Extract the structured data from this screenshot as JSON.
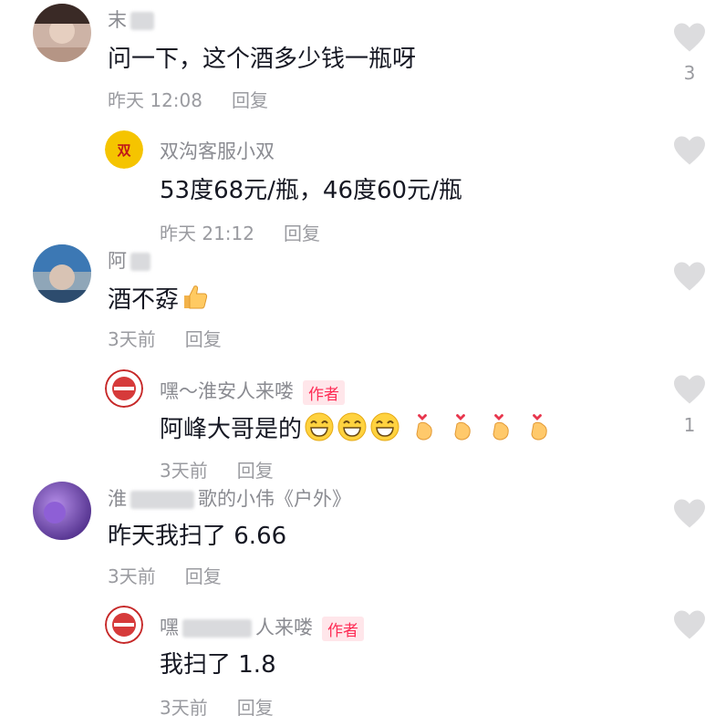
{
  "comments": [
    {
      "name": "末",
      "text": "问一下，这个酒多少钱一瓶呀",
      "time": "昨天 12:08",
      "reply_label": "回复",
      "likes": "3",
      "replies": [
        {
          "name": "双沟客服小双",
          "text": "53度68元/瓶，46度60元/瓶",
          "time": "昨天 21:12",
          "reply_label": "回复"
        }
      ]
    },
    {
      "name": "阿",
      "text": "酒不孬",
      "emoji": "thumbs-up",
      "time": "3天前",
      "reply_label": "回复",
      "replies": [
        {
          "name": "嘿～淮安人来喽",
          "author_tag": "作者",
          "text": "阿峰大哥是的",
          "emoji": [
            "grin",
            "grin",
            "grin",
            "finger-heart",
            "finger-heart",
            "finger-heart",
            "finger-heart"
          ],
          "time": "3天前",
          "reply_label": "回复",
          "likes": "1"
        }
      ]
    },
    {
      "name_prefix": "淮",
      "name_suffix": "歌的小伟《户外》",
      "text": "昨天我扫了 6.66",
      "time": "3天前",
      "reply_label": "回复",
      "replies": [
        {
          "name_prefix": "嘿",
          "name_suffix": "人来喽",
          "author_tag": "作者",
          "text": "我扫了 1.8",
          "time": "3天前",
          "reply_label": "回复"
        }
      ]
    }
  ],
  "colors": {
    "text": "#161823",
    "secondary": "#8a8b91",
    "meta": "#9a9ba0",
    "heart": "#dcdcde",
    "author_tag": "#fe2c55"
  }
}
